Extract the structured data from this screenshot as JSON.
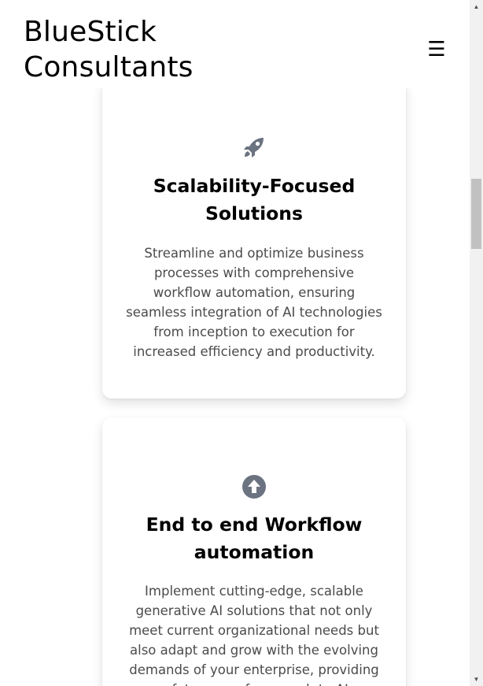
{
  "header": {
    "brand_line1": "BlueStick",
    "brand_line2": "Consultants",
    "menu_glyph": "☰"
  },
  "cards": [
    {
      "icon": "rocket-icon",
      "title_line1": "Scalability-Focused",
      "title_line2": "Solutions",
      "description": "Streamline and optimize business processes with comprehensive workflow automation, ensuring seamless integration of AI technologies from inception to execution for increased efficiency and productivity."
    },
    {
      "icon": "arrow-circle-up-icon",
      "title_line1": "End to end Workflow",
      "title_line2": "automation",
      "description": "Implement cutting-edge, scalable generative AI solutions that not only meet current organizational needs but also adapt and grow with the evolving demands of your enterprise, providing a future-proof approach to AI integration."
    }
  ],
  "scrollbar": {
    "up_glyph": "▲",
    "down_glyph": "▼"
  },
  "colors": {
    "icon": "#6b7280",
    "text_body": "#4b4b4b",
    "scroll_track": "#f1f1f1",
    "scroll_thumb": "#c1c1c1"
  }
}
